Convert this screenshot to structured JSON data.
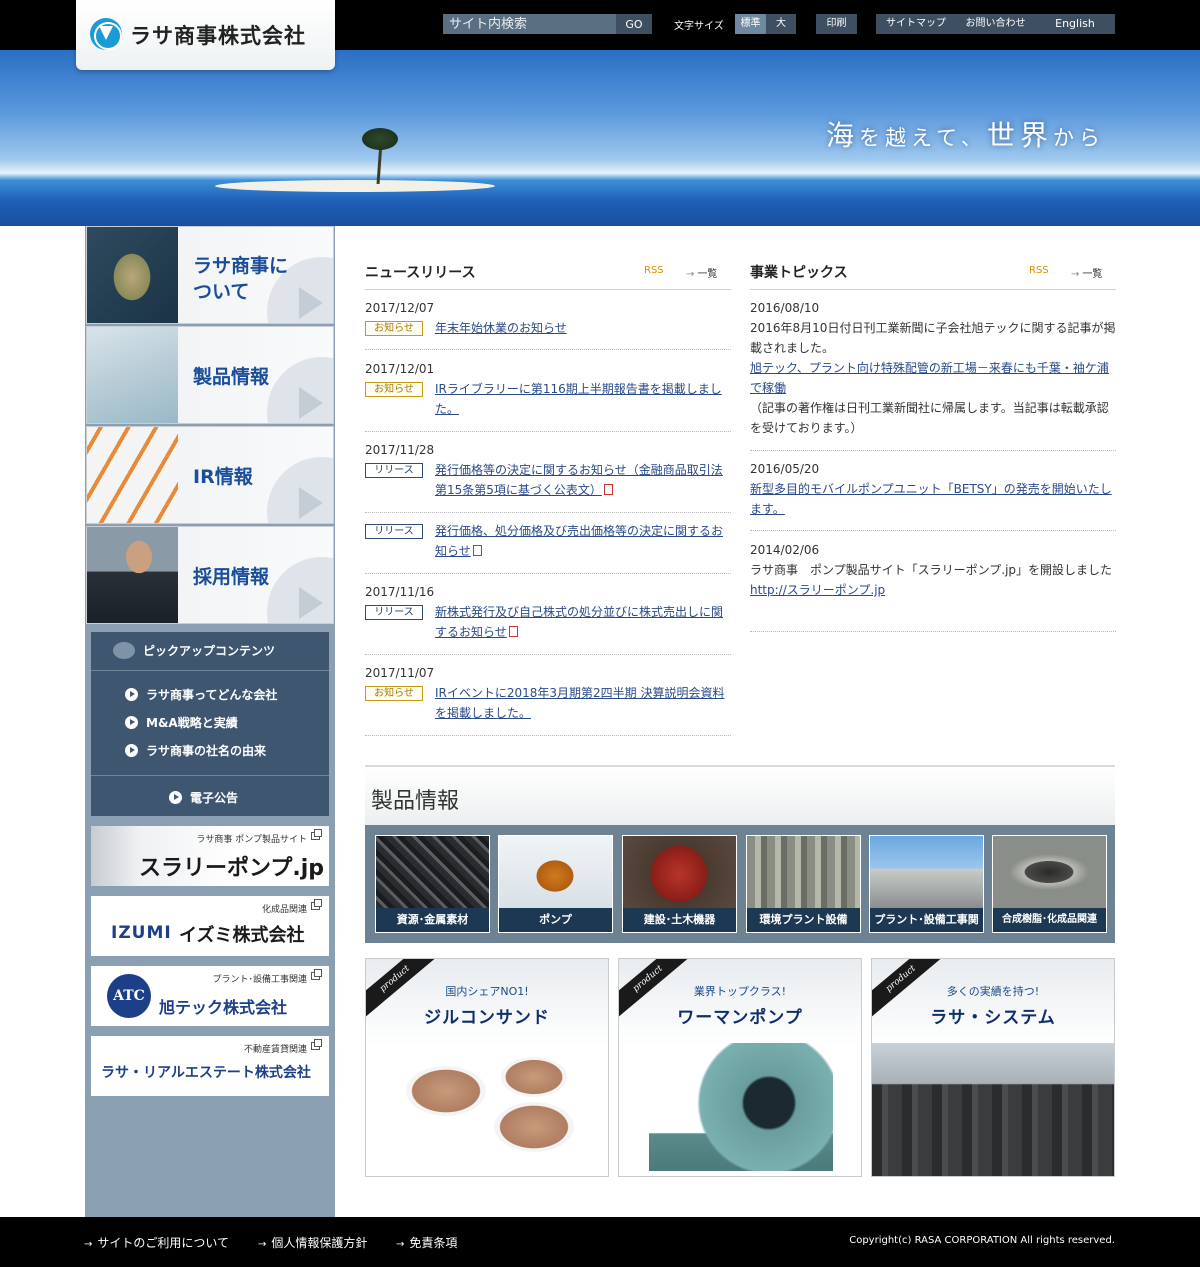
{
  "header": {
    "logo_text": "ラサ商事株式会社",
    "search_placeholder": "サイト内検索",
    "search_button": "GO",
    "font_size_label": "文字サイズ",
    "font_standard": "標準",
    "font_large": "大",
    "print": "印刷",
    "sitemap": "サイトマップ",
    "contact": "お問い合わせ",
    "english": "English"
  },
  "hero": {
    "tagline_1": "海",
    "tagline_2": "を越えて、",
    "tagline_3": "世界",
    "tagline_4": "から"
  },
  "sidebar": {
    "nav": [
      {
        "label_1": "ラサ商事に",
        "label_2": "ついて"
      },
      {
        "label_1": "製品情報"
      },
      {
        "label_1": "IR情報"
      },
      {
        "label_1": "採用情報"
      }
    ],
    "pickup_title": "ピックアップコンテンツ",
    "pickup_items": [
      "ラサ商事ってどんな会社",
      "M&A戦略と実績",
      "ラサ商事の社名の由来"
    ],
    "denshi": "電子公告",
    "banners": [
      {
        "caption": "ラサ商事 ポンプ製品サイト",
        "name": "スラリーポンプ.jp"
      },
      {
        "caption": "化成品関連",
        "brand": "IZUMI",
        "name": "イズミ株式会社"
      },
      {
        "caption": "プラント･設備工事関連",
        "brand": "ATC",
        "name": "旭テック株式会社"
      },
      {
        "caption": "不動産賃貸関連",
        "name": "ラサ・リアルエステート株式会社"
      }
    ]
  },
  "news": {
    "title": "ニュースリリース",
    "rss": "RSS",
    "list": "一覧",
    "items": [
      {
        "date": "2017/12/07",
        "badge": "お知らせ",
        "text": "年末年始休業のお知らせ"
      },
      {
        "date": "2017/12/01",
        "badge": "お知らせ",
        "text": "IRライブラリーに第116期上半期報告書を掲載しました。"
      },
      {
        "date": "2017/11/28",
        "badge": "リリース",
        "text": "発行価格等の決定に関するお知らせ（金融商品取引法第15条第5項に基づく公表文）"
      },
      {
        "date": "",
        "badge": "リリース",
        "text": "発行価格、処分価格及び売出価格等の決定に関するお知らせ"
      },
      {
        "date": "2017/11/16",
        "badge": "リリース",
        "text": "新株式発行及び自己株式の処分並びに株式売出しに関するお知らせ"
      },
      {
        "date": "2017/11/07",
        "badge": "お知らせ",
        "text": "IRイベントに2018年3月期第2四半期 決算説明会資料を掲載しました。"
      }
    ]
  },
  "topics": {
    "title": "事業トピックス",
    "rss": "RSS",
    "list": "一覧",
    "items": [
      {
        "date": "2016/08/10",
        "pre": "2016年8月10日付日刊工業新聞に子会社旭テックに関する記事が掲載されました。",
        "link": "旭テック、プラント向け特殊配管の新工場－来春にも千葉・袖ケ浦で稼働",
        "post": "（記事の著作権は日刊工業新聞社に帰属します。当記事は転載承認を受けております。）"
      },
      {
        "date": "2016/05/20",
        "pre": "",
        "link": "新型多目的モバイルポンプユニット「BETSY」の発売を開始いたします。",
        "post": ""
      },
      {
        "date": "2014/02/06",
        "pre": "ラサ商事　ポンプ製品サイト「スラリーポンプ.jp」を開設しました",
        "link": "http://スラリーポンプ.jp",
        "post": ""
      }
    ]
  },
  "products": {
    "title": "製品情報",
    "categories": [
      "資源･金属素材",
      "ポンプ",
      "建設･土木機器",
      "環境プラント設備",
      "プラント･設備工事関連",
      "合成樹脂･化成品関連"
    ],
    "featured": [
      {
        "ribbon": "product",
        "tag": "国内シェアNO1!",
        "title": "ジルコンサンド"
      },
      {
        "ribbon": "product",
        "tag": "業界トップクラス!",
        "title": "ワーマンポンプ"
      },
      {
        "ribbon": "product",
        "tag": "多くの実績を持つ!",
        "title": "ラサ・システム"
      }
    ]
  },
  "footer": {
    "links": [
      "サイトのご利用について",
      "個人情報保護方針",
      "免責条項"
    ],
    "copyright": "Copyright(c) RASA CORPORATION All rights reserved."
  }
}
